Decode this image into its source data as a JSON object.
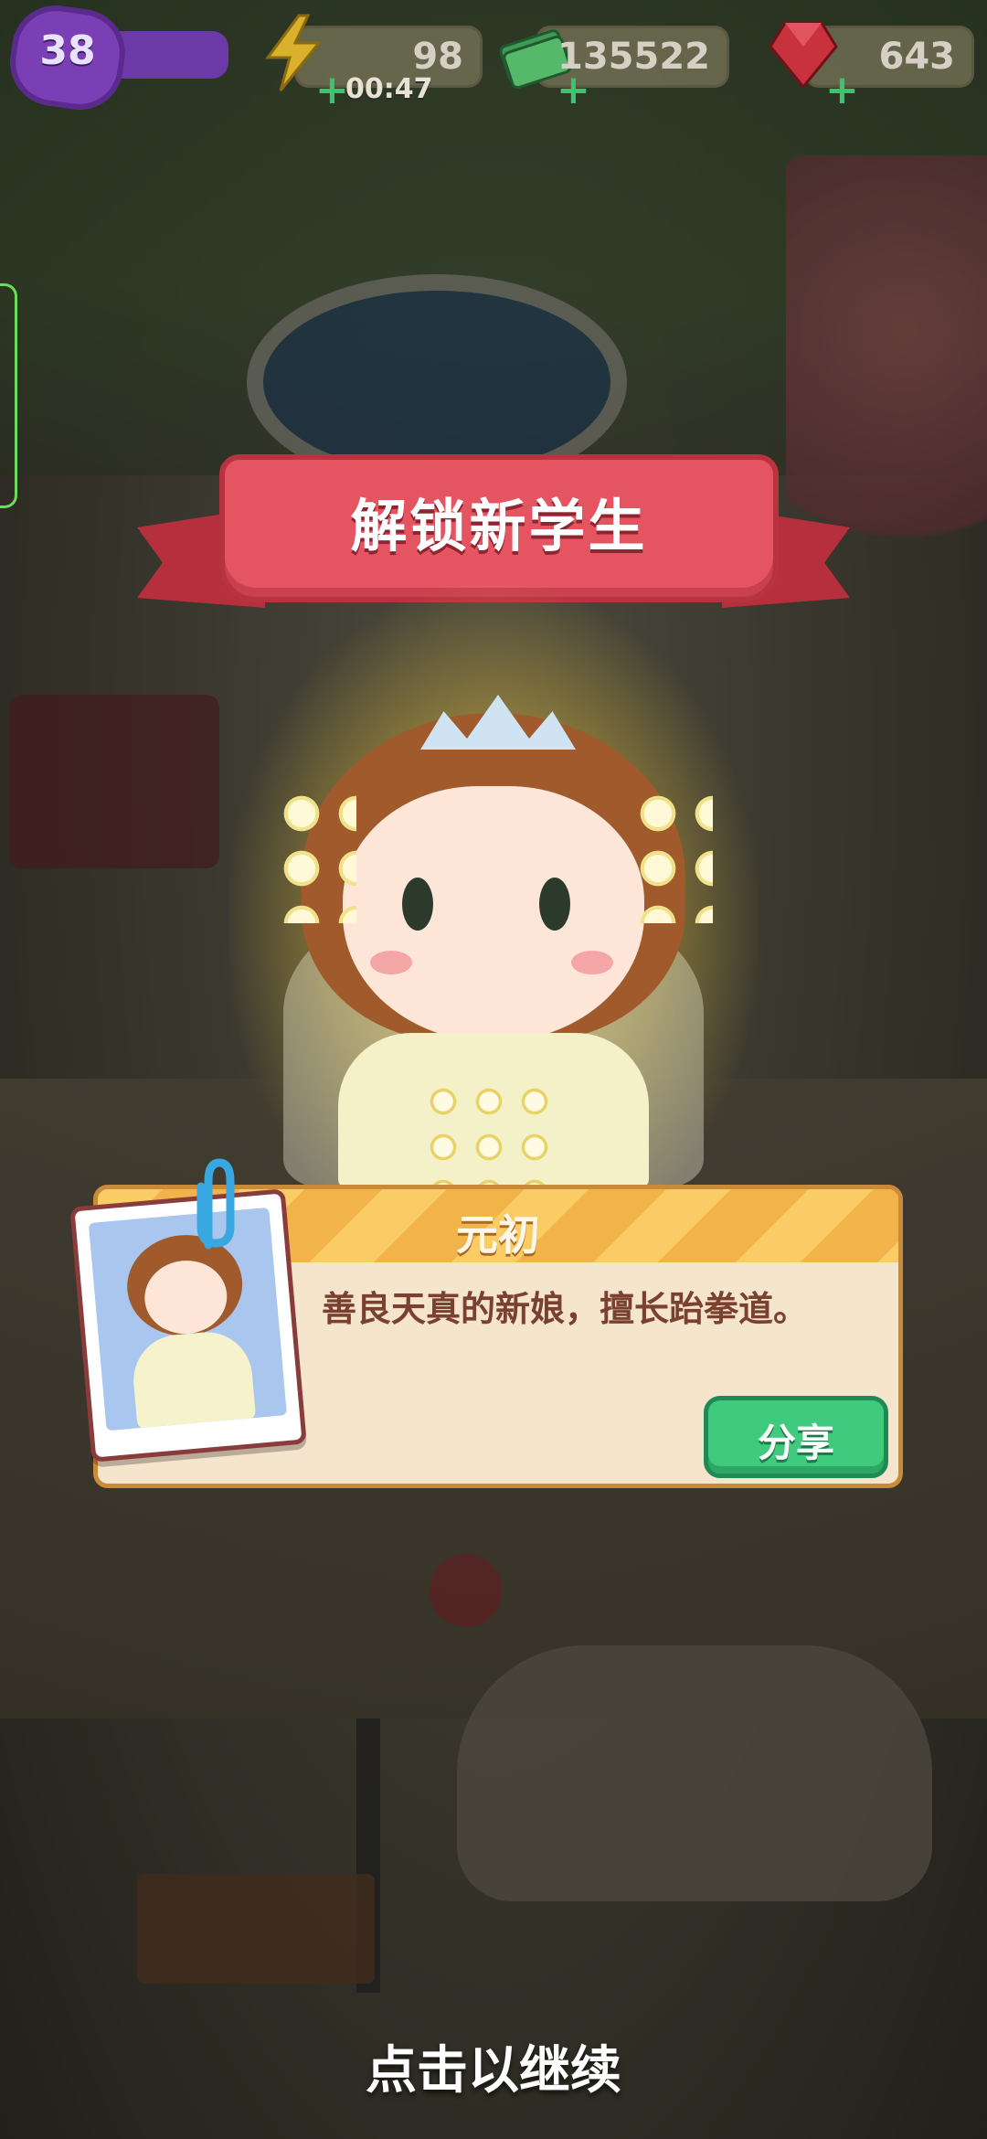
{
  "hud": {
    "level": "38",
    "energy": "98",
    "energy_timer": "00:47",
    "coins": "135522",
    "gems": "643"
  },
  "unlock": {
    "banner_title": "解锁新学生",
    "student_name": "元初",
    "student_description": "善良天真的新娘，擅长跆拳道。",
    "share_label": "分享"
  },
  "footer": {
    "continue_prompt": "点击以继续"
  },
  "icons": {
    "level": "purple-star-badge-icon",
    "energy": "lightning-bolt-icon",
    "coins": "cash-stack-icon",
    "gems": "red-gem-icon",
    "add": "plus-icon",
    "clip": "paperclip-icon"
  },
  "colors": {
    "ribbon": "#e45461",
    "card_header": "#f2b34a",
    "share_button": "#3fca7d",
    "level_badge": "#7a3fb5"
  }
}
